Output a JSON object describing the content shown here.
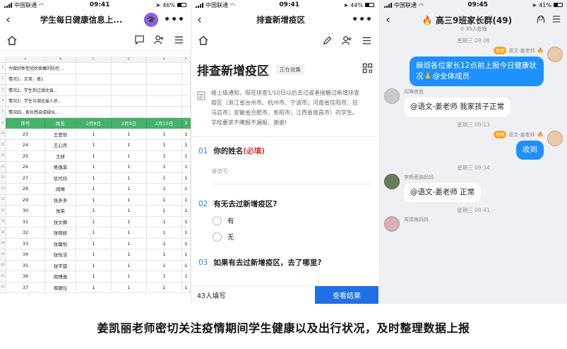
{
  "status_bars": [
    {
      "carrier": "中国联通",
      "time": "09:41",
      "battery": "46%"
    },
    {
      "carrier": "中国联通",
      "time": "09:41",
      "battery": "44%"
    },
    {
      "carrier": "中国联通",
      "time": "09:45",
      "battery": "41%"
    }
  ],
  "sheet_screen": {
    "title": "学生每日健康信息上...",
    "col_letters": [
      "A",
      "B",
      "C",
      "D",
      "E",
      "F"
    ],
    "notes": [
      {
        "row": "1",
        "text": "为做好新型冠状病毒的防控..."
      },
      {
        "row": "2",
        "text": "情况1、正常，填1"
      },
      {
        "row": "3",
        "text": "情况2、学生到过湖北省..."
      },
      {
        "row": "4",
        "text": "情况3、学生与湖北省人员..."
      },
      {
        "row": "5",
        "text": "情况四、家长感染或疑似..."
      }
    ],
    "headers": {
      "row": "6",
      "cols": [
        "序号",
        "姓名",
        "2月8日",
        "2月9日",
        "2月10日",
        "2"
      ]
    },
    "rows": [
      {
        "rn": "28",
        "no": "23",
        "name": "王思怡",
        "d": [
          "1",
          "1",
          "1",
          "1"
        ]
      },
      {
        "rn": "29",
        "no": "24",
        "name": "王心月",
        "d": [
          "1",
          "1",
          "1",
          "1"
        ]
      },
      {
        "rn": "30",
        "no": "25",
        "name": "王妍",
        "d": [
          "1",
          "1",
          "1",
          "1"
        ]
      },
      {
        "rn": "31",
        "no": "26",
        "name": "吴逸菲",
        "d": [
          "1",
          "1",
          "1",
          "1"
        ]
      },
      {
        "rn": "32",
        "no": "27",
        "name": "徐可欣",
        "d": [
          "1",
          "1",
          "1",
          "1"
        ]
      },
      {
        "rn": "33",
        "no": "28",
        "name": "阎琳",
        "d": [
          "1",
          "1",
          "1",
          "1"
        ]
      },
      {
        "rn": "34",
        "no": "29",
        "name": "张多多",
        "d": [
          "1",
          "1",
          "1",
          "1"
        ]
      },
      {
        "rn": "35",
        "no": "30",
        "name": "张荣",
        "d": [
          "1",
          "1",
          "1",
          "1"
        ]
      },
      {
        "rn": "36",
        "no": "31",
        "name": "张文卿",
        "d": [
          "1",
          "1",
          "1",
          "1"
        ]
      },
      {
        "rn": "37",
        "no": "32",
        "name": "张晓娇",
        "d": [
          "1",
          "1",
          "1",
          "1"
        ]
      },
      {
        "rn": "38",
        "no": "33",
        "name": "张馨怡",
        "d": [
          "1",
          "1",
          "1",
          "1"
        ]
      },
      {
        "rn": "39",
        "no": "34",
        "name": "张怡洁",
        "d": [
          "1",
          "1",
          "1",
          "1"
        ]
      },
      {
        "rn": "40",
        "no": "35",
        "name": "张宇旋",
        "d": [
          "1",
          "1",
          "1",
          "1"
        ]
      },
      {
        "rn": "41",
        "no": "36",
        "name": "周博逸",
        "d": [
          "1",
          "1",
          "1",
          "1"
        ]
      },
      {
        "rn": "42",
        "no": "37",
        "name": "周琚仪",
        "d": [
          "1",
          "1",
          "1",
          "1"
        ]
      }
    ]
  },
  "survey_screen": {
    "nav_title": "排查新增疫区",
    "title": "排查新增疫区",
    "badge": "正在收集",
    "notice": "接上级通知，现在排查1/10日以后去过或者接触过新增排查疫区（浙江省台州市、杭州市、宁波市；河南省信阳市、驻马店市；安徽省合肥市、阜阳市；江西省南昌市）的学生。学校要求不瞒报不漏报，谢谢!",
    "q1": {
      "num": "01",
      "text": "你的姓名",
      "required": "(必填)",
      "placeholder": "请填写"
    },
    "q2": {
      "num": "02",
      "text": "有无去过新增疫区?",
      "options": [
        "有",
        "无"
      ]
    },
    "q3": {
      "num": "03",
      "text": "如果有去过新增疫区，去了哪里?"
    },
    "filled_count": "43人填写",
    "result_button": "查看结果"
  },
  "chat_screen": {
    "title": "🔥 高三9班家长群(49)",
    "online": "⊙ 35人在线",
    "messages": [
      {
        "time": "星期三 09:06",
        "side": "right",
        "tag": "老师",
        "sender": "语文-姜老师",
        "text": "麻烦各位家长12点前上报今日健康状况🙏@全体成员",
        "style": "blue",
        "avatar": "teacher"
      },
      {
        "time": "",
        "side": "left",
        "tag": "",
        "sender": "阎琳爸爸",
        "text": "@语文-姜老师 我家孩子正常",
        "style": "white",
        "avatar": "parent1"
      },
      {
        "time": "星期三 09:13",
        "side": "right",
        "tag": "老师",
        "sender": "语文-姜老师",
        "text": "收到",
        "style": "blue",
        "avatar": "teacher"
      },
      {
        "time": "星期三 09:34",
        "side": "left",
        "tag": "",
        "sender": "李杨思瑜妈妈",
        "text": "@语文-姜老师 正常",
        "style": "white",
        "avatar": "parent2"
      },
      {
        "time": "星期三 09:41",
        "side": "left",
        "tag": "",
        "sender": "周靖逸妈妈",
        "text": "",
        "style": "white",
        "avatar": "parent3"
      }
    ]
  },
  "caption": "姜凯丽老师密切关注疫情期间学生健康以及出行状况，及时整理数据上报",
  "colors": {
    "accent_blue": "#1e90ff",
    "sheet_green": "#45b26b",
    "required_red": "#e53935",
    "teacher_tag": "#f5a623"
  }
}
